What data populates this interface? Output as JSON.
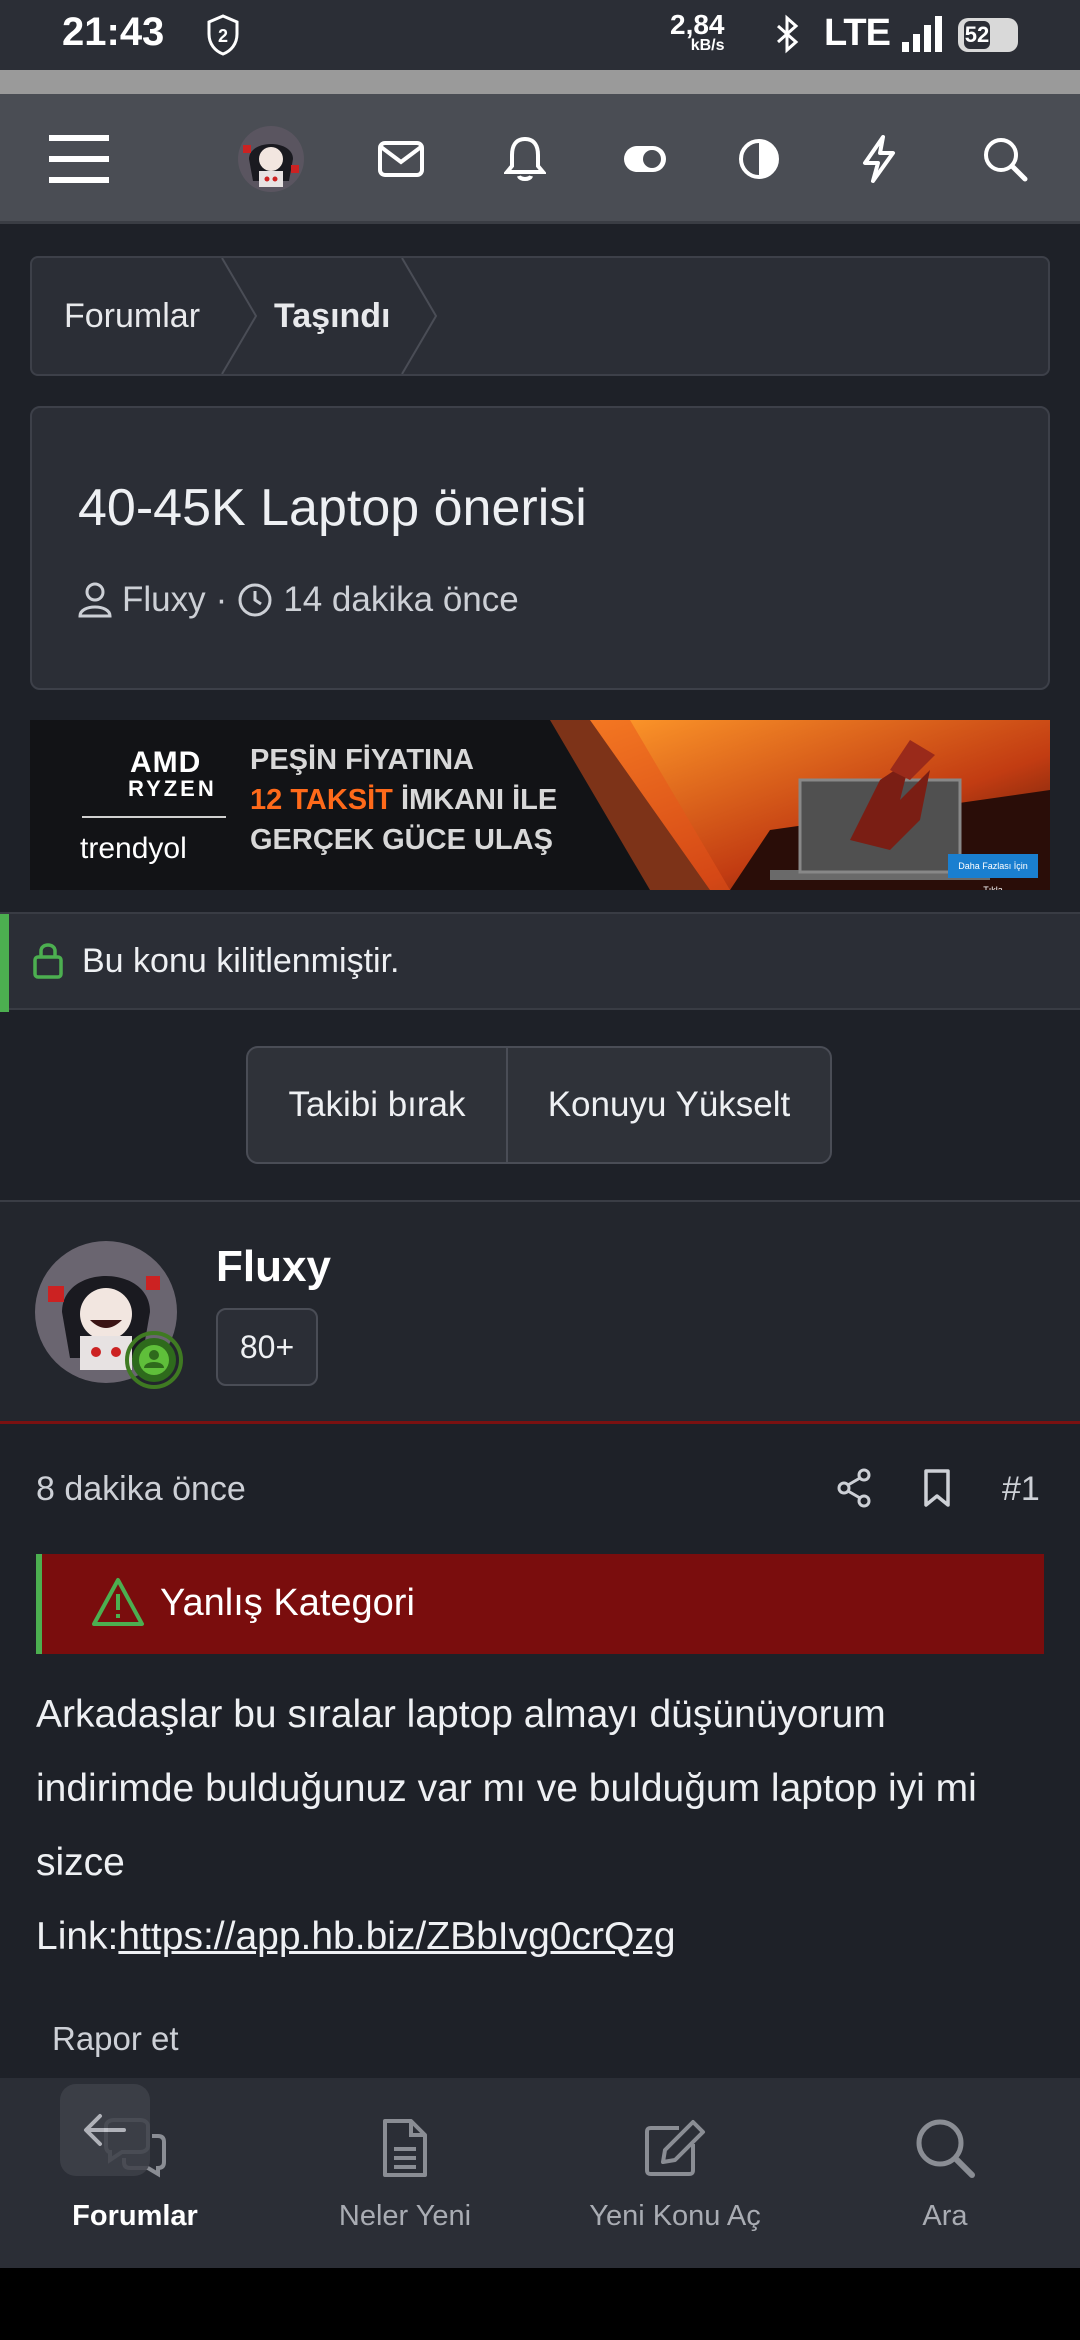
{
  "status_bar": {
    "time": "21:43",
    "net_speed": "2,84",
    "net_unit": "kB/s",
    "network": "LTE",
    "battery": "52"
  },
  "breadcrumb": {
    "items": [
      "Forumlar",
      "Taşındı"
    ]
  },
  "thread": {
    "title": "40-45K Laptop önerisi",
    "author": "Fluxy",
    "separator": "·",
    "time_ago": "14 dakika önce"
  },
  "banner": {
    "brand_amd": "AMD",
    "brand_ryzen": "RYZEN",
    "brand_trendyol": "trendyol",
    "line1": "PEŞİN FİYATINA",
    "line2_highlight": "12 TAKSİT",
    "line2_rest": " İMKANI İLE",
    "line3": "GERÇEK GÜCE ULAŞ",
    "cta": "Daha Fazlası İçin Tıkla"
  },
  "lock_notice": "Bu konu kilitlenmiştir.",
  "actions": {
    "unfollow": "Takibi bırak",
    "bump": "Konuyu Yükselt"
  },
  "post": {
    "author": "Fluxy",
    "badge": "80+",
    "time_ago": "8 dakika önce",
    "number": "#1",
    "warning": "Yanlış Kategori",
    "text_line1": "Arkadaşlar bu sıralar laptop almayı düşünüyorum indirimde bulduğunuz var mı ve bulduğum laptop iyi mi sizce",
    "link_label": "Link:",
    "link_url": "https://app.hb.biz/ZBbIvg0crQzg",
    "report": "Rapor et"
  },
  "bottom_nav": {
    "items": [
      "Forumlar",
      "Neler Yeni",
      "Yeni Konu Aç",
      "Ara"
    ]
  },
  "colors": {
    "accent_green": "#4caf50",
    "warning_red": "#7a0d0d",
    "banner_orange": "#ff6a1a"
  }
}
